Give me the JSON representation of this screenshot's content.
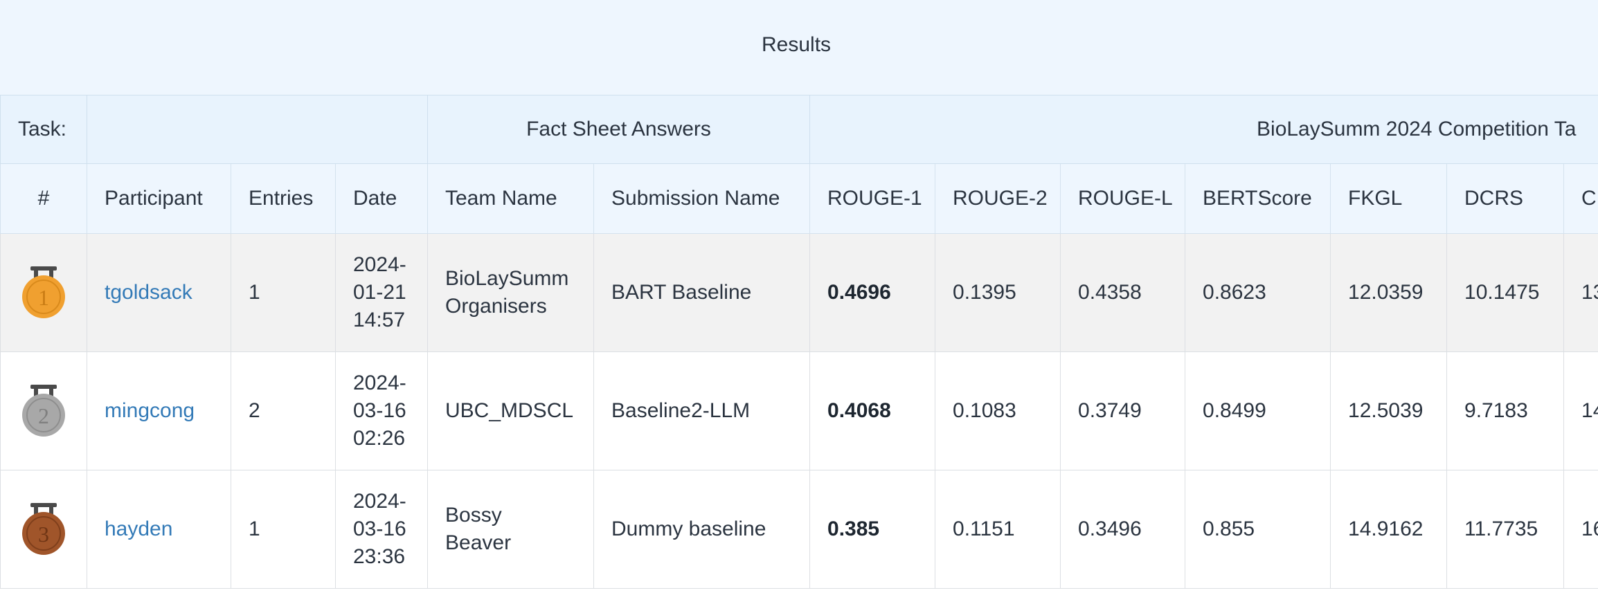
{
  "results_title": "Results",
  "task_row": {
    "task_label": "Task:",
    "fact_sheet_label": "Fact Sheet Answers",
    "competition_label": "BioLaySumm 2024 Competition Ta"
  },
  "columns": {
    "rank": "#",
    "participant": "Participant",
    "entries": "Entries",
    "date": "Date",
    "team_name": "Team Name",
    "submission_name": "Submission Name",
    "rouge1": "ROUGE-1",
    "rouge2": "ROUGE-2",
    "rougel": "ROUGE-L",
    "bertscore": "BERTScore",
    "fkgl": "FKGL",
    "dcrs": "DCRS",
    "next": "C"
  },
  "rows": [
    {
      "medal": "1",
      "medal_color": "#f0a030",
      "participant": "tgoldsack",
      "entries": "1",
      "date_l1": "2024-",
      "date_l2": "01-21",
      "date_l3": "14:57",
      "team_l1": "BioLaySumm",
      "team_l2": "Organisers",
      "submission": "BART Baseline",
      "rouge1": "0.4696",
      "rouge2": "0.1395",
      "rougel": "0.4358",
      "bertscore": "0.8623",
      "fkgl": "12.0359",
      "dcrs": "10.1475",
      "next": "13"
    },
    {
      "medal": "2",
      "medal_color": "#a8a8a8",
      "participant": "mingcong",
      "entries": "2",
      "date_l1": "2024-",
      "date_l2": "03-16",
      "date_l3": "02:26",
      "team_l1": "UBC_MDSCL",
      "team_l2": "",
      "submission": "Baseline2-LLM",
      "rouge1": "0.4068",
      "rouge2": "0.1083",
      "rougel": "0.3749",
      "bertscore": "0.8499",
      "fkgl": "12.5039",
      "dcrs": "9.7183",
      "next": "14"
    },
    {
      "medal": "3",
      "medal_color": "#a0552a",
      "participant": "hayden",
      "entries": "1",
      "date_l1": "2024-",
      "date_l2": "03-16",
      "date_l3": "23:36",
      "team_l1": "Bossy",
      "team_l2": "Beaver",
      "submission": "Dummy baseline",
      "rouge1": "0.385",
      "rouge2": "0.1151",
      "rougel": "0.3496",
      "bertscore": "0.855",
      "fkgl": "14.9162",
      "dcrs": "11.7735",
      "next": "16"
    }
  ]
}
